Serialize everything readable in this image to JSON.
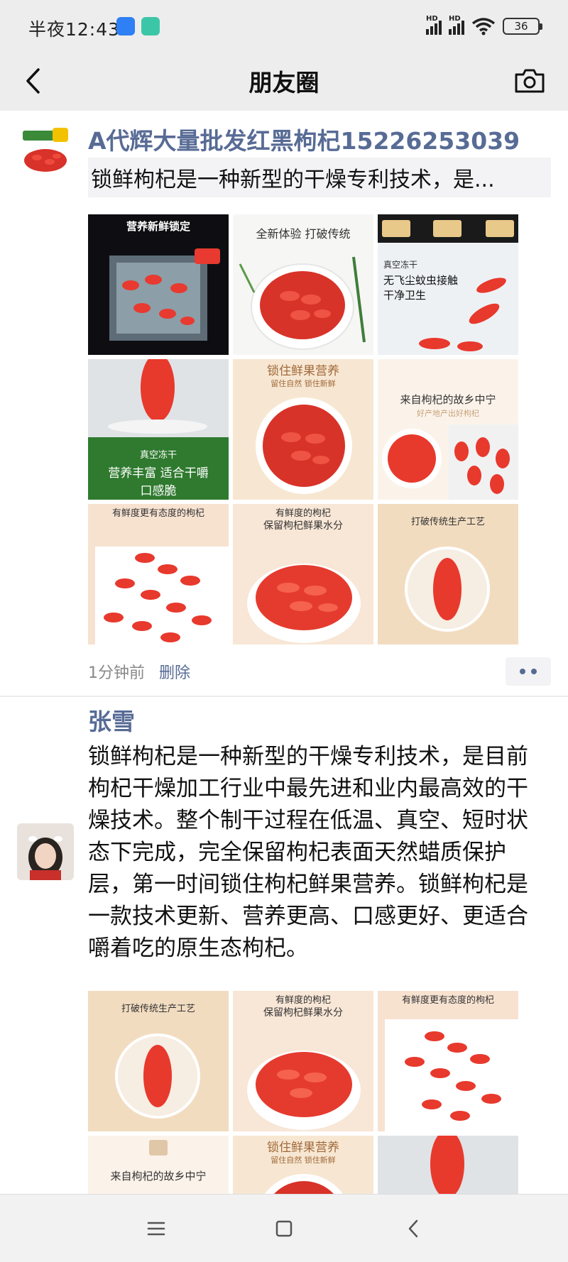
{
  "status_bar": {
    "time": "半夜12:43",
    "signal_1": "HD",
    "signal_2": "HD",
    "battery": "36"
  },
  "nav": {
    "title": "朋友圈"
  },
  "posts": [
    {
      "author": "A代辉大量批发红黑枸杞15226253039",
      "share_text": "锁鲜枸杞是一种新型的干燥专利技术，是...",
      "images": [
        {
          "caption": "营养新鲜锁定",
          "sub": ""
        },
        {
          "caption": "全新体验 打破传统",
          "sub": ""
        },
        {
          "caption": "真空冻干",
          "sub": "无飞尘蚊虫接触 干净卫生"
        },
        {
          "caption": "真空冻干",
          "sub": "营养丰富 适合干嚼口感脆"
        },
        {
          "caption": "锁住鲜果营养",
          "sub": "留住自然 锁住新鲜"
        },
        {
          "caption": "来自枸杞的故乡中宁",
          "sub": "好产地产出好枸杞"
        },
        {
          "caption": "有鲜度更有态度的枸杞",
          "sub": ""
        },
        {
          "caption": "有鲜度的枸杞",
          "sub": "保留枸杞鲜果水分"
        },
        {
          "caption": "打破传统生产工艺",
          "sub": ""
        }
      ],
      "time": "1分钟前",
      "delete_label": "删除"
    },
    {
      "author": "张雪",
      "text": "锁鲜枸杞是一种新型的干燥专利技术，是目前枸杞干燥加工行业中最先进和业内最高效的干燥技术。整个制干过程在低温、真空、短时状态下完成，完全保留枸杞表面天然蜡质保护层，第一时间锁住枸杞鲜果营养。锁鲜枸杞是一款技术更新、营养更高、口感更好、更适合嚼着吃的原生态枸杞。",
      "images": [
        {
          "caption": "打破传统生产工艺",
          "sub": ""
        },
        {
          "caption": "有鲜度的枸杞",
          "sub": "保留枸杞鲜果水分"
        },
        {
          "caption": "有鲜度更有态度的枸杞",
          "sub": ""
        },
        {
          "caption": "来自枸杞的故乡中宁",
          "sub": ""
        },
        {
          "caption": "锁住鲜果营养",
          "sub": "留住自然 锁住新鲜"
        },
        {
          "caption": "",
          "sub": ""
        }
      ]
    }
  ],
  "colors": {
    "link_blue": "#576b95",
    "goji_red": "#e8392d",
    "background": "#ededed"
  }
}
